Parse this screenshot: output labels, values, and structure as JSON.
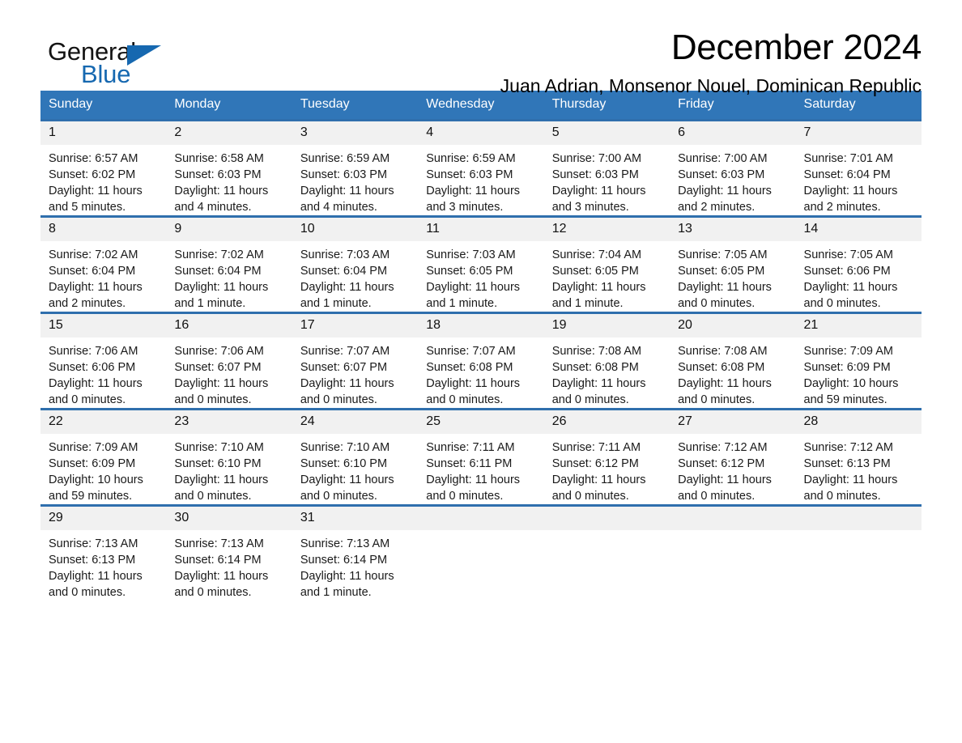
{
  "brand": {
    "word_general": "General",
    "word_blue": "Blue",
    "triangle_icon": "triangle-icon",
    "accent_color": "#1668b0"
  },
  "header": {
    "month_title": "December 2024",
    "location": "Juan Adrian, Monsenor Nouel, Dominican Republic"
  },
  "calendar": {
    "header_bg": "#3076b8",
    "row_rule_color": "#2f6fad",
    "daynum_bg": "#f1f1f1",
    "weekday_headers": [
      "Sunday",
      "Monday",
      "Tuesday",
      "Wednesday",
      "Thursday",
      "Friday",
      "Saturday"
    ],
    "weeks": [
      [
        {
          "day": "1",
          "sunrise": "Sunrise: 6:57 AM",
          "sunset": "Sunset: 6:02 PM",
          "daylight_1": "Daylight: 11 hours",
          "daylight_2": "and 5 minutes."
        },
        {
          "day": "2",
          "sunrise": "Sunrise: 6:58 AM",
          "sunset": "Sunset: 6:03 PM",
          "daylight_1": "Daylight: 11 hours",
          "daylight_2": "and 4 minutes."
        },
        {
          "day": "3",
          "sunrise": "Sunrise: 6:59 AM",
          "sunset": "Sunset: 6:03 PM",
          "daylight_1": "Daylight: 11 hours",
          "daylight_2": "and 4 minutes."
        },
        {
          "day": "4",
          "sunrise": "Sunrise: 6:59 AM",
          "sunset": "Sunset: 6:03 PM",
          "daylight_1": "Daylight: 11 hours",
          "daylight_2": "and 3 minutes."
        },
        {
          "day": "5",
          "sunrise": "Sunrise: 7:00 AM",
          "sunset": "Sunset: 6:03 PM",
          "daylight_1": "Daylight: 11 hours",
          "daylight_2": "and 3 minutes."
        },
        {
          "day": "6",
          "sunrise": "Sunrise: 7:00 AM",
          "sunset": "Sunset: 6:03 PM",
          "daylight_1": "Daylight: 11 hours",
          "daylight_2": "and 2 minutes."
        },
        {
          "day": "7",
          "sunrise": "Sunrise: 7:01 AM",
          "sunset": "Sunset: 6:04 PM",
          "daylight_1": "Daylight: 11 hours",
          "daylight_2": "and 2 minutes."
        }
      ],
      [
        {
          "day": "8",
          "sunrise": "Sunrise: 7:02 AM",
          "sunset": "Sunset: 6:04 PM",
          "daylight_1": "Daylight: 11 hours",
          "daylight_2": "and 2 minutes."
        },
        {
          "day": "9",
          "sunrise": "Sunrise: 7:02 AM",
          "sunset": "Sunset: 6:04 PM",
          "daylight_1": "Daylight: 11 hours",
          "daylight_2": "and 1 minute."
        },
        {
          "day": "10",
          "sunrise": "Sunrise: 7:03 AM",
          "sunset": "Sunset: 6:04 PM",
          "daylight_1": "Daylight: 11 hours",
          "daylight_2": "and 1 minute."
        },
        {
          "day": "11",
          "sunrise": "Sunrise: 7:03 AM",
          "sunset": "Sunset: 6:05 PM",
          "daylight_1": "Daylight: 11 hours",
          "daylight_2": "and 1 minute."
        },
        {
          "day": "12",
          "sunrise": "Sunrise: 7:04 AM",
          "sunset": "Sunset: 6:05 PM",
          "daylight_1": "Daylight: 11 hours",
          "daylight_2": "and 1 minute."
        },
        {
          "day": "13",
          "sunrise": "Sunrise: 7:05 AM",
          "sunset": "Sunset: 6:05 PM",
          "daylight_1": "Daylight: 11 hours",
          "daylight_2": "and 0 minutes."
        },
        {
          "day": "14",
          "sunrise": "Sunrise: 7:05 AM",
          "sunset": "Sunset: 6:06 PM",
          "daylight_1": "Daylight: 11 hours",
          "daylight_2": "and 0 minutes."
        }
      ],
      [
        {
          "day": "15",
          "sunrise": "Sunrise: 7:06 AM",
          "sunset": "Sunset: 6:06 PM",
          "daylight_1": "Daylight: 11 hours",
          "daylight_2": "and 0 minutes."
        },
        {
          "day": "16",
          "sunrise": "Sunrise: 7:06 AM",
          "sunset": "Sunset: 6:07 PM",
          "daylight_1": "Daylight: 11 hours",
          "daylight_2": "and 0 minutes."
        },
        {
          "day": "17",
          "sunrise": "Sunrise: 7:07 AM",
          "sunset": "Sunset: 6:07 PM",
          "daylight_1": "Daylight: 11 hours",
          "daylight_2": "and 0 minutes."
        },
        {
          "day": "18",
          "sunrise": "Sunrise: 7:07 AM",
          "sunset": "Sunset: 6:08 PM",
          "daylight_1": "Daylight: 11 hours",
          "daylight_2": "and 0 minutes."
        },
        {
          "day": "19",
          "sunrise": "Sunrise: 7:08 AM",
          "sunset": "Sunset: 6:08 PM",
          "daylight_1": "Daylight: 11 hours",
          "daylight_2": "and 0 minutes."
        },
        {
          "day": "20",
          "sunrise": "Sunrise: 7:08 AM",
          "sunset": "Sunset: 6:08 PM",
          "daylight_1": "Daylight: 11 hours",
          "daylight_2": "and 0 minutes."
        },
        {
          "day": "21",
          "sunrise": "Sunrise: 7:09 AM",
          "sunset": "Sunset: 6:09 PM",
          "daylight_1": "Daylight: 10 hours",
          "daylight_2": "and 59 minutes."
        }
      ],
      [
        {
          "day": "22",
          "sunrise": "Sunrise: 7:09 AM",
          "sunset": "Sunset: 6:09 PM",
          "daylight_1": "Daylight: 10 hours",
          "daylight_2": "and 59 minutes."
        },
        {
          "day": "23",
          "sunrise": "Sunrise: 7:10 AM",
          "sunset": "Sunset: 6:10 PM",
          "daylight_1": "Daylight: 11 hours",
          "daylight_2": "and 0 minutes."
        },
        {
          "day": "24",
          "sunrise": "Sunrise: 7:10 AM",
          "sunset": "Sunset: 6:10 PM",
          "daylight_1": "Daylight: 11 hours",
          "daylight_2": "and 0 minutes."
        },
        {
          "day": "25",
          "sunrise": "Sunrise: 7:11 AM",
          "sunset": "Sunset: 6:11 PM",
          "daylight_1": "Daylight: 11 hours",
          "daylight_2": "and 0 minutes."
        },
        {
          "day": "26",
          "sunrise": "Sunrise: 7:11 AM",
          "sunset": "Sunset: 6:12 PM",
          "daylight_1": "Daylight: 11 hours",
          "daylight_2": "and 0 minutes."
        },
        {
          "day": "27",
          "sunrise": "Sunrise: 7:12 AM",
          "sunset": "Sunset: 6:12 PM",
          "daylight_1": "Daylight: 11 hours",
          "daylight_2": "and 0 minutes."
        },
        {
          "day": "28",
          "sunrise": "Sunrise: 7:12 AM",
          "sunset": "Sunset: 6:13 PM",
          "daylight_1": "Daylight: 11 hours",
          "daylight_2": "and 0 minutes."
        }
      ],
      [
        {
          "day": "29",
          "sunrise": "Sunrise: 7:13 AM",
          "sunset": "Sunset: 6:13 PM",
          "daylight_1": "Daylight: 11 hours",
          "daylight_2": "and 0 minutes."
        },
        {
          "day": "30",
          "sunrise": "Sunrise: 7:13 AM",
          "sunset": "Sunset: 6:14 PM",
          "daylight_1": "Daylight: 11 hours",
          "daylight_2": "and 0 minutes."
        },
        {
          "day": "31",
          "sunrise": "Sunrise: 7:13 AM",
          "sunset": "Sunset: 6:14 PM",
          "daylight_1": "Daylight: 11 hours",
          "daylight_2": "and 1 minute."
        },
        {
          "day": "",
          "sunrise": "",
          "sunset": "",
          "daylight_1": "",
          "daylight_2": ""
        },
        {
          "day": "",
          "sunrise": "",
          "sunset": "",
          "daylight_1": "",
          "daylight_2": ""
        },
        {
          "day": "",
          "sunrise": "",
          "sunset": "",
          "daylight_1": "",
          "daylight_2": ""
        },
        {
          "day": "",
          "sunrise": "",
          "sunset": "",
          "daylight_1": "",
          "daylight_2": ""
        }
      ]
    ]
  }
}
